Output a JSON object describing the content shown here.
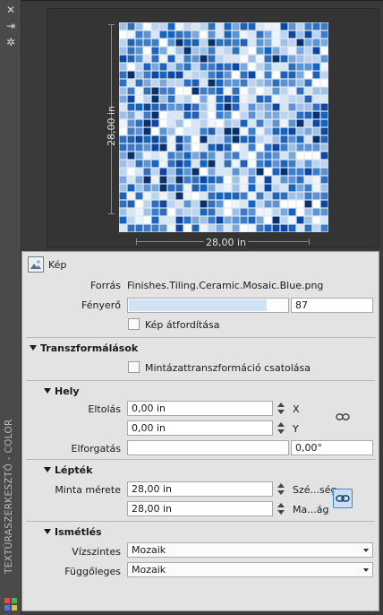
{
  "palette": {
    "mosaic": [
      "#08306b",
      "#0d47a1",
      "#1565c0",
      "#1e63b5",
      "#2f6fbd",
      "#3d7cc9",
      "#5b93d3",
      "#7aa8dc",
      "#9fc1e7",
      "#bcd4ef",
      "#d7e5f5",
      "#eef4fb",
      "#ffffff"
    ]
  },
  "sidebar": {
    "title": "TEXTÚRASZERKESZTŐ - COLOR",
    "icons": [
      "close-icon",
      "pin-icon",
      "settings-icon"
    ]
  },
  "preview": {
    "height_dim": "28,00 in",
    "width_dim": "28,00 in"
  },
  "image_section": {
    "title": "Kép",
    "source_label": "Forrás",
    "source_value": "Finishes.Tiling.Ceramic.Mosaic.Blue.png",
    "brightness_label": "Fényerő",
    "brightness_value": "87",
    "brightness_fraction": 0.87,
    "invert_label": "Kép átfordítása"
  },
  "transforms": {
    "title": "Transzformálások",
    "link_label": "Mintázattranszformáció csatolása"
  },
  "position": {
    "title": "Hely",
    "offset_label": "Eltolás",
    "offset_x": "0,00 in",
    "offset_y": "0,00 in",
    "x_axis": "X",
    "y_axis": "Y",
    "rotation_label": "Elforgatás",
    "rotation_value": "0,00°"
  },
  "scale": {
    "title": "Lépték",
    "sample_label": "Minta mérete",
    "width_value": "28,00 in",
    "height_value": "28,00 in",
    "width_unit": "Szé...ség",
    "height_unit": "Ma...ág"
  },
  "repeat": {
    "title": "Ismétlés",
    "horizontal_label": "Vízszintes",
    "horizontal_value": "Mozaik",
    "vertical_label": "Függőleges",
    "vertical_value": "Mozaik"
  }
}
